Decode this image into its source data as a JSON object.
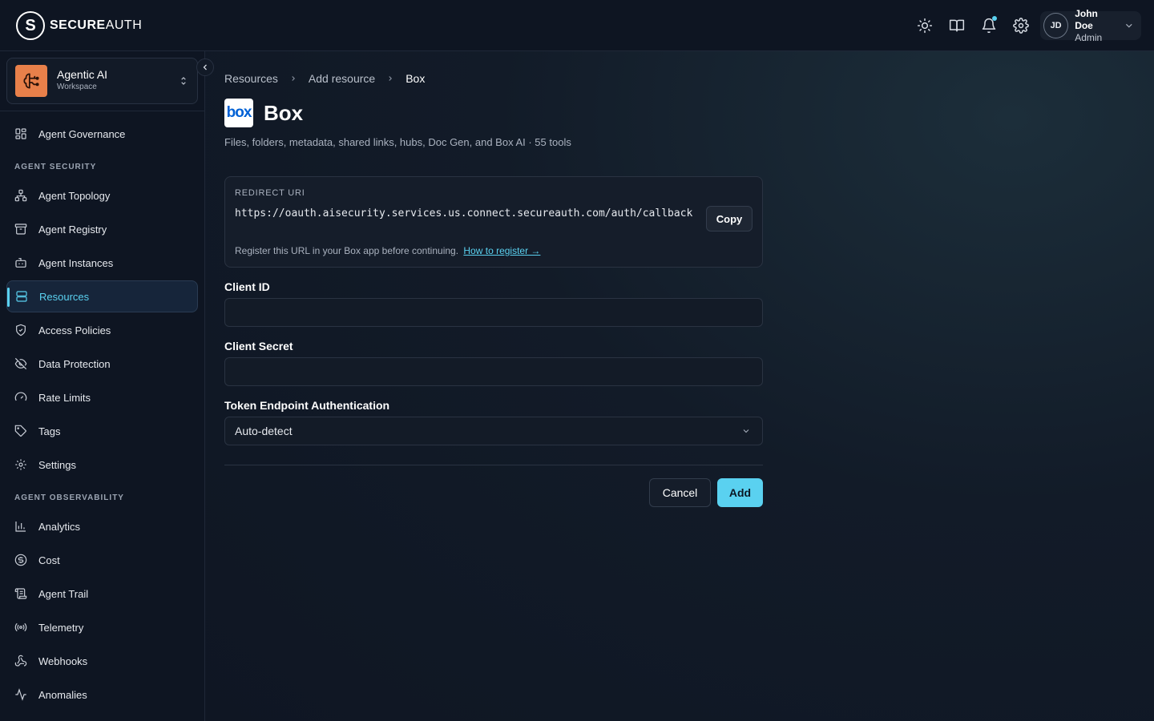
{
  "header": {
    "brand_bold": "SECURE",
    "brand_light": "AUTH",
    "brand_mark": "S",
    "icons": [
      "sun-icon",
      "book-icon",
      "bell-icon",
      "gear-icon"
    ],
    "user": {
      "initials": "JD",
      "name": "John Doe",
      "role": "Admin"
    }
  },
  "workspace": {
    "name": "Agentic AI",
    "sub": "Workspace"
  },
  "sidebar": {
    "top_item": {
      "label": "Agent Governance",
      "icon": "dashboard-icon"
    },
    "sections": [
      {
        "label": "AGENT SECURITY",
        "items": [
          {
            "label": "Agent Topology",
            "icon": "topology-icon"
          },
          {
            "label": "Agent Registry",
            "icon": "archive-icon"
          },
          {
            "label": "Agent Instances",
            "icon": "bot-icon"
          },
          {
            "label": "Resources",
            "icon": "server-icon",
            "active": true
          },
          {
            "label": "Access Policies",
            "icon": "shield-icon"
          },
          {
            "label": "Data Protection",
            "icon": "eye-off-icon"
          },
          {
            "label": "Rate Limits",
            "icon": "gauge-icon"
          },
          {
            "label": "Tags",
            "icon": "tag-icon"
          },
          {
            "label": "Settings",
            "icon": "gear-icon"
          }
        ]
      },
      {
        "label": "AGENT OBSERVABILITY",
        "items": [
          {
            "label": "Analytics",
            "icon": "bar-chart-icon"
          },
          {
            "label": "Cost",
            "icon": "dollar-icon"
          },
          {
            "label": "Agent Trail",
            "icon": "scroll-icon"
          },
          {
            "label": "Telemetry",
            "icon": "radio-icon"
          },
          {
            "label": "Webhooks",
            "icon": "webhook-icon"
          },
          {
            "label": "Anomalies",
            "icon": "activity-icon"
          }
        ]
      }
    ]
  },
  "breadcrumb": [
    "Resources",
    "Add resource",
    "Box"
  ],
  "page": {
    "logo_text": "box",
    "title": "Box",
    "subtitle": "Files, folders, metadata, shared links, hubs, Doc Gen, and Box AI · 55 tools"
  },
  "redirect": {
    "label": "REDIRECT URI",
    "uri": "https://oauth.aisecurity.services.us.connect.secureauth.com/auth/callback",
    "copy_label": "Copy",
    "help_text": "Register this URL in your Box app before continuing.",
    "help_link": "How to register →"
  },
  "form": {
    "client_id": {
      "label": "Client ID",
      "value": "",
      "placeholder": ""
    },
    "client_secret": {
      "label": "Client Secret",
      "value": "",
      "placeholder": ""
    },
    "token_auth": {
      "label": "Token Endpoint Authentication",
      "value": "Auto-detect"
    },
    "cancel_label": "Cancel",
    "add_label": "Add"
  },
  "colors": {
    "accent": "#5ad1f0",
    "workspace_logo": "#e8804a",
    "background": "#0f1623"
  }
}
